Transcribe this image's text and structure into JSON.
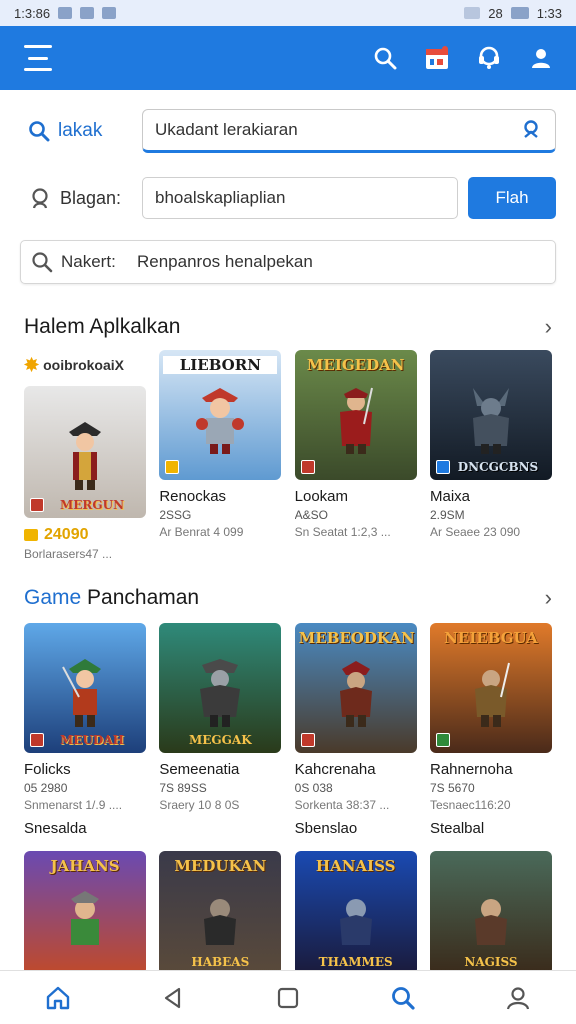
{
  "status": {
    "time_left": "1:3:86",
    "time_right": "1:33",
    "signal": "28"
  },
  "search": {
    "row1_label": "lakak",
    "row1_value": "Ukadant lerakiaran",
    "row2_label": "Blagan:",
    "row2_value": "bhoalskapliaplian",
    "row2_button": "Flah",
    "row3_label": "Nakert:",
    "row3_value": "Renpanros henalpekan"
  },
  "section1": {
    "title": "Halem Aplkalkan",
    "first_card_label": "ooibrokoaiX",
    "cards": [
      {
        "banner": "",
        "foot": "MERGUN",
        "name": "",
        "price": "24090",
        "size": "",
        "meta": "Borlarasers47 ..."
      },
      {
        "banner": "LIEBORN",
        "foot": "",
        "name": "Renockas",
        "size": "2SSG",
        "meta": "Ar Benrat 4 099"
      },
      {
        "banner": "MEIGEDAN",
        "foot": "",
        "name": "Lookam",
        "size": "A&SO",
        "meta": "Sn Seatat 1:2,3 ..."
      },
      {
        "banner": "",
        "foot": "DNCGCBNS",
        "name": "Maixa",
        "size": "2.9SM",
        "meta": "Ar Seaee 23 090"
      }
    ]
  },
  "section2": {
    "title_accent": "Game",
    "title_rest": " Panchaman",
    "cards": [
      {
        "banner": "",
        "foot": "MEUDAH",
        "name": "Folicks",
        "size": "05 2980",
        "meta": "Snmenarst 1/.9 ....",
        "extra": "Snesalda"
      },
      {
        "banner": "",
        "foot": "MEGGAK",
        "name": "Semeenatia",
        "size": "7S 89SS",
        "meta": "Sraery 10 8 0S",
        "extra": ""
      },
      {
        "banner": "MEBEODKAN",
        "foot": "",
        "name": "Kahcrenaha",
        "size": "0S 038",
        "meta": "Sorkenta 38:37 ...",
        "extra": "Sbenslao"
      },
      {
        "banner": "NEIEBGUA",
        "foot": "",
        "name": "Rahnernoha",
        "size": "7S 5670",
        "meta": "Tesnaec116:20",
        "extra": "Stealbal"
      }
    ]
  },
  "section3": {
    "cards": [
      {
        "banner": "JAHANS",
        "foot": ""
      },
      {
        "banner": "MEDUKAN",
        "foot": "HABEAS"
      },
      {
        "banner": "HANAISS",
        "foot": "THAMMES"
      },
      {
        "banner": "",
        "foot": "NAGISS"
      }
    ]
  },
  "colors": {
    "primary": "#1f7ae0",
    "accent_gold": "#f5c24a"
  },
  "icons": [
    "menu-icon",
    "search-icon",
    "calendar-icon",
    "headset-icon",
    "profile-icon",
    "home-icon",
    "back-icon",
    "recents-icon",
    "search-nav-icon",
    "user-nav-icon"
  ]
}
